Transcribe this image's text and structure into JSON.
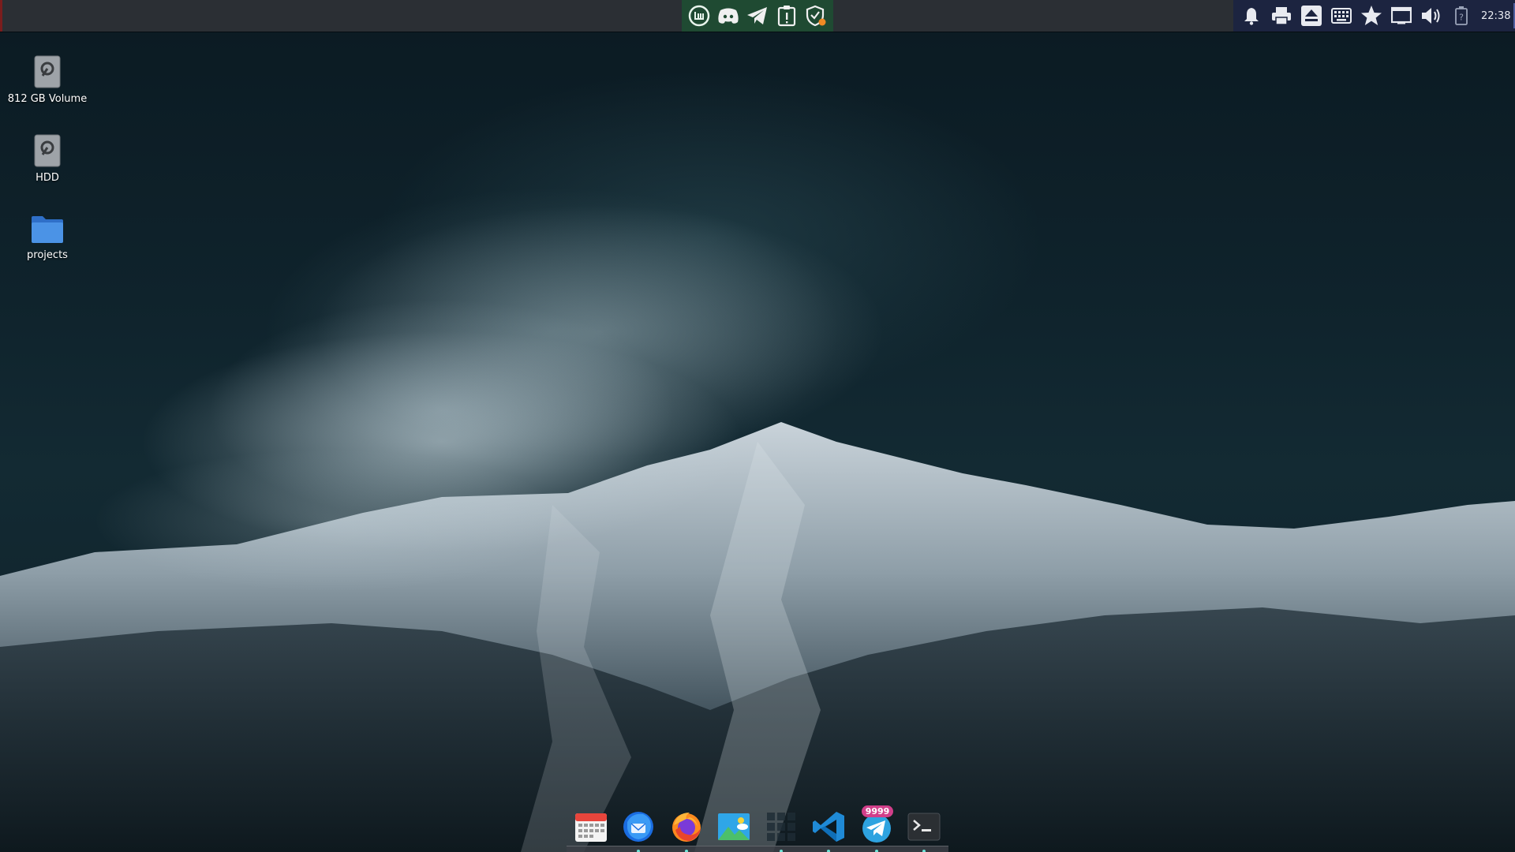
{
  "desktop": {
    "icons": [
      {
        "label": "812 GB Volume",
        "icon": "drive-icon"
      },
      {
        "label": "HDD",
        "icon": "drive-icon"
      },
      {
        "label": "projects",
        "icon": "folder-icon"
      }
    ]
  },
  "top_panel": {
    "center_launchers": [
      "linux-mint-menu-icon",
      "discord-icon",
      "telegram-icon",
      "clipboard-icon",
      "shield-updates-icon"
    ],
    "tray": {
      "icons": [
        "notifications-icon",
        "printer-icon",
        "eject-icon",
        "keyboard-icon",
        "star-icon",
        "display-icon",
        "volume-icon",
        "battery-unknown-icon"
      ],
      "clock": "22:38"
    }
  },
  "dock": {
    "items": [
      {
        "name": "calendar-icon",
        "running": false
      },
      {
        "name": "thunderbird-icon",
        "running": true
      },
      {
        "name": "firefox-icon",
        "running": true
      },
      {
        "name": "image-viewer-icon",
        "running": false
      },
      {
        "name": "app-grid-icon",
        "running": true
      },
      {
        "name": "vscode-icon",
        "running": true
      },
      {
        "name": "telegram-icon",
        "running": true,
        "badge": "9999"
      },
      {
        "name": "terminal-icon",
        "running": true
      }
    ]
  },
  "colors": {
    "panel": "#2b2f34",
    "launcher_group": "#1f4a32",
    "tray_group": "#1c2440",
    "dock_indicator": "#6fe3d6",
    "badge": "#d13f8a"
  }
}
